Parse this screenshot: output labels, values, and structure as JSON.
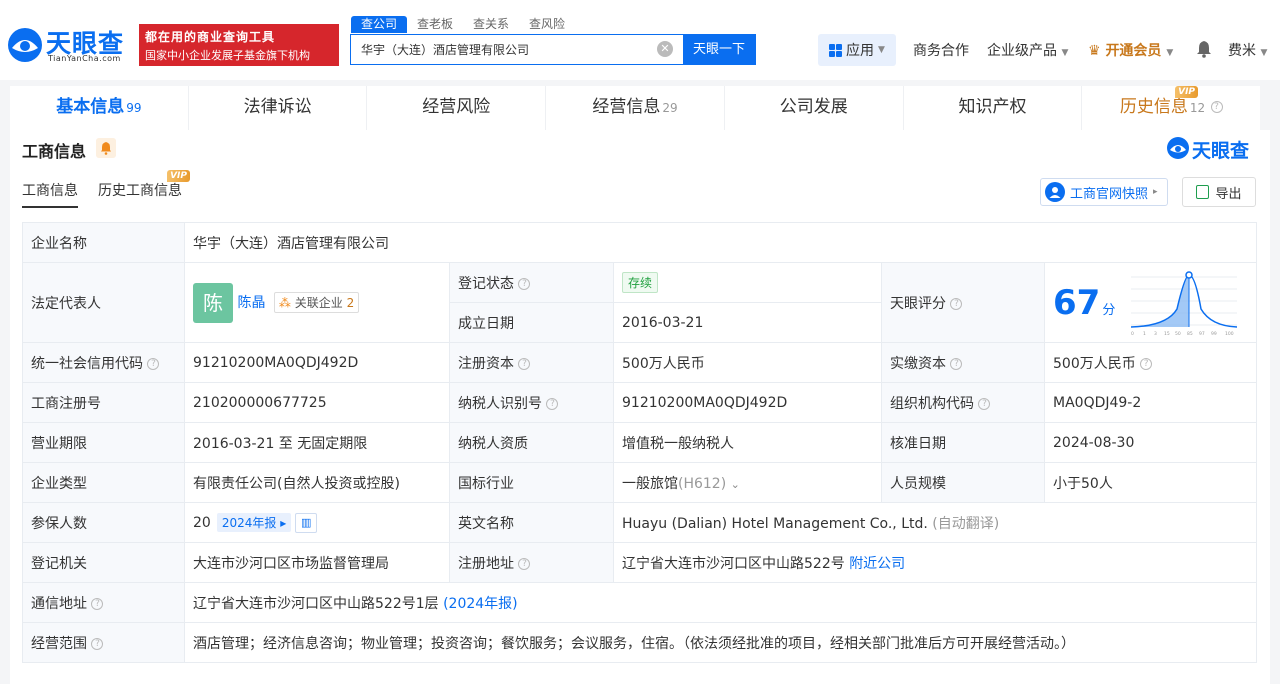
{
  "header": {
    "logo_text": "天眼查",
    "logo_sub": "TianYanCha.com",
    "promo_line1": "都在用的商业查询工具",
    "promo_line2": "国家中小企业发展子基金旗下机构",
    "search_tabs": [
      "查公司",
      "查老板",
      "查关系",
      "查风险"
    ],
    "search_value": "华宇（大连）酒店管理有限公司",
    "search_button": "天眼一下",
    "nav_app": "应用",
    "nav_items": [
      "商务合作",
      "企业级产品",
      "开通会员",
      "费米"
    ],
    "accent": "#0a6ef0"
  },
  "tabs": [
    {
      "label": "基本信息",
      "count": "99"
    },
    {
      "label": "法律诉讼",
      "count": ""
    },
    {
      "label": "经营风险",
      "count": ""
    },
    {
      "label": "经营信息",
      "count": "29"
    },
    {
      "label": "公司发展",
      "count": ""
    },
    {
      "label": "知识产权",
      "count": ""
    },
    {
      "label": "历史信息",
      "count": "12"
    }
  ],
  "vip_label": "VIP",
  "section": {
    "title": "工商信息",
    "brand": "天眼查",
    "sub_tabs": [
      "工商信息",
      "历史工商信息"
    ],
    "snapshot_button": "工商官网快照",
    "export_button": "导出"
  },
  "company": {
    "name_label": "企业名称",
    "name": "华宇（大连）酒店管理有限公司",
    "legal_rep_label": "法定代表人",
    "legal_rep_avatar": "陈",
    "legal_rep": "陈晶",
    "related_label": "关联企业",
    "related_count": "2",
    "status_label": "登记状态",
    "status": "存续",
    "founded_label": "成立日期",
    "founded": "2016-03-21",
    "score_label": "天眼评分",
    "score": "67",
    "score_unit": "分",
    "credit_code_label": "统一社会信用代码",
    "credit_code": "91210200MA0QDJ492D",
    "reg_capital_label": "注册资本",
    "reg_capital": "500万人民币",
    "paid_capital_label": "实缴资本",
    "paid_capital": "500万人民币",
    "reg_no_label": "工商注册号",
    "reg_no": "210200000677725",
    "taxpayer_id_label": "纳税人识别号",
    "taxpayer_id": "91210200MA0QDJ492D",
    "org_code_label": "组织机构代码",
    "org_code": "MA0QDJ49-2",
    "term_label": "营业期限",
    "term": "2016-03-21 至 无固定期限",
    "taxpayer_qual_label": "纳税人资质",
    "taxpayer_qual": "增值税一般纳税人",
    "approve_date_label": "核准日期",
    "approve_date": "2024-08-30",
    "type_label": "企业类型",
    "type": "有限责任公司(自然人投资或控股)",
    "industry_label": "国标行业",
    "industry": "一般旅馆",
    "industry_code": "(H612)",
    "staff_size_label": "人员规模",
    "staff_size": "小于50人",
    "insured_label": "参保人数",
    "insured": "20",
    "insured_year": "2024年报",
    "english_name_label": "英文名称",
    "english_name": "Huayu (Dalian) Hotel Management Co., Ltd.",
    "auto_translate": "(自动翻译)",
    "authority_label": "登记机关",
    "authority": "大连市沙河口区市场监督管理局",
    "reg_address_label": "注册地址",
    "reg_address": "辽宁省大连市沙河口区中山路522号",
    "nearby": "附近公司",
    "mail_address_label": "通信地址",
    "mail_address": "辽宁省大连市沙河口区中山路522号1层",
    "mail_year": "(2024年报)",
    "scope_label": "经营范围",
    "scope": "酒店管理；经济信息咨询；物业管理；投资咨询；餐饮服务；会议服务，住宿。（依法须经批准的项目，经相关部门批准后方可开展经营活动。）"
  }
}
